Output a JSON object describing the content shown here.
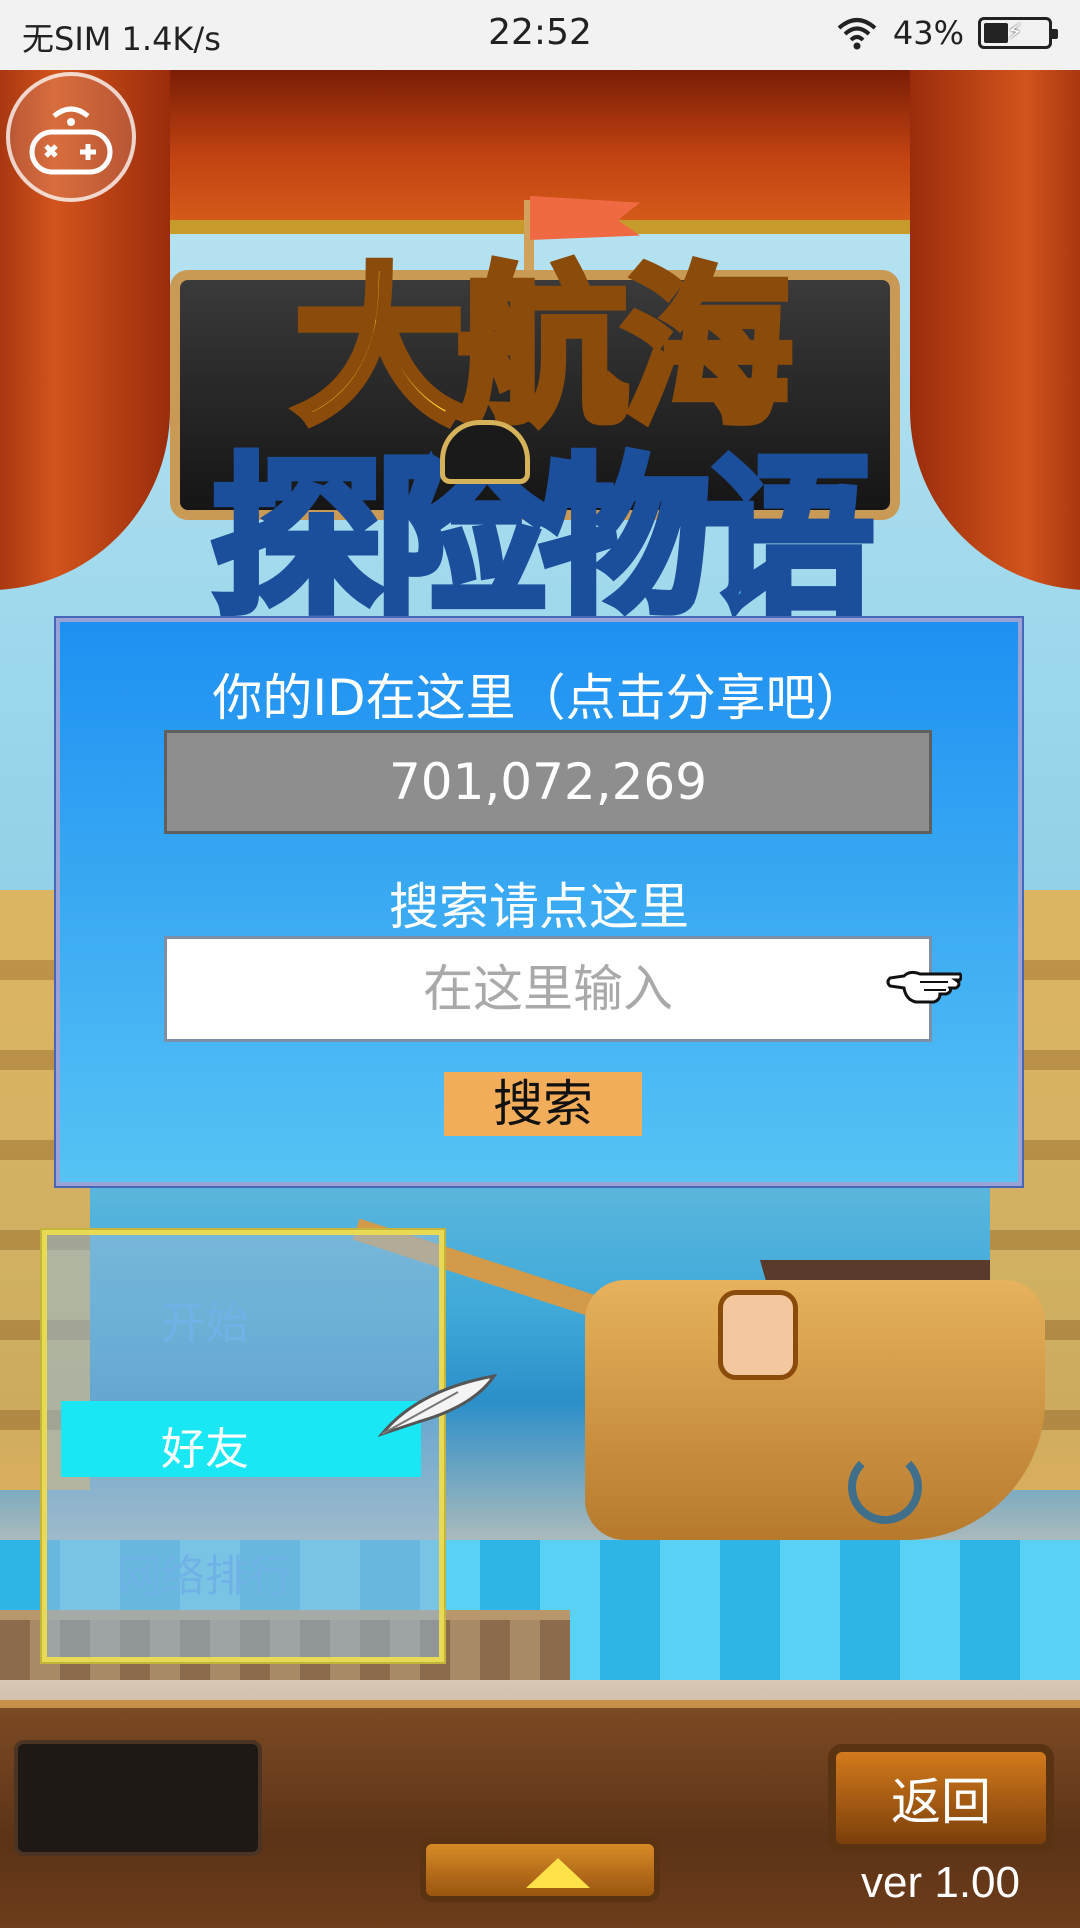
{
  "status_bar": {
    "carrier": "无SIM 1.4K/s",
    "time": "22:52",
    "battery": "43%"
  },
  "game": {
    "logo_line1": "大航海",
    "logo_line2": "探险物语"
  },
  "id_dialog": {
    "title": "你的ID在这里（点击分享吧）",
    "id_value": "701,072,269",
    "search_title": "搜索请点这里",
    "search_placeholder": "在这里输入",
    "search_button": "搜索"
  },
  "menu": {
    "items": [
      {
        "label": "开始"
      },
      {
        "label": "好友",
        "selected": true
      },
      {
        "label": "网络排行"
      }
    ]
  },
  "bottom_bar": {
    "back_label": "返回",
    "version": "ver 1.00"
  },
  "colors": {
    "dialog_blue": "#1e90f2",
    "highlight_cyan": "#19e7f4",
    "button_orange": "#f2ad5a"
  },
  "icons": [
    "wifi-icon",
    "battery-icon",
    "gamepad-icon",
    "pointing-hand-icon",
    "quill-icon",
    "up-arrow-icon"
  ]
}
